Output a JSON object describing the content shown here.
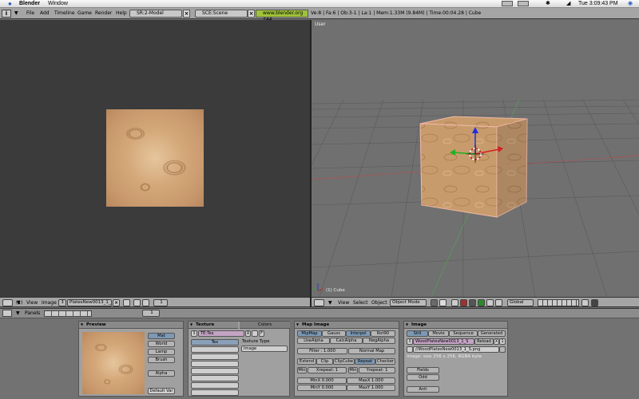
{
  "mac_menu": {
    "app": "Blender",
    "window": "Window",
    "clock": "Tue 3:09:43 PM"
  },
  "header": {
    "menus": [
      "File",
      "Add",
      "Timeline",
      "Game",
      "Render",
      "Help"
    ],
    "screen": "SR:2-Model",
    "scene": "SCE:Scene",
    "url": "www.blender.org 244",
    "stats": "Ve:8 | Fa:6 | Ob:3-1 | La:1  | Mem:1.33M (9.84M)  | Time:00:04.28 | Cube"
  },
  "view3d": {
    "label": "User",
    "object_label": "(1) Cube"
  },
  "image_header": {
    "view": "View",
    "image_label": "Image",
    "image_name": "PlatesNew0013_1_S",
    "frame": "1"
  },
  "view3d_header": {
    "frame": "(1)",
    "menus": [
      "View",
      "Select",
      "Object"
    ],
    "mode": "Object Mode",
    "orientation": "Global"
  },
  "props": {
    "panels_label": "Panels",
    "frame": "1",
    "preview": {
      "title": "Preview",
      "buttons": [
        "Mat",
        "World",
        "Lamp",
        "Brush",
        "Alpha",
        "Default Var"
      ]
    },
    "texture": {
      "tab_texture": "Texture",
      "tab_colors": "Colors",
      "name": "TE:Tex",
      "x": "X",
      "f": "F",
      "list_header": "Tex",
      "type_label": "Texture Type",
      "type_value": "Image"
    },
    "map_image": {
      "title": "Map Image",
      "row1": [
        "MipMap",
        "Gauss",
        "Interpol",
        "Rot90"
      ],
      "row2": [
        "UseAlpha",
        "CalcAlpha",
        "NegAlpha"
      ],
      "filter": "Filter : 1.000",
      "normal_map": "Normal Map",
      "row3": [
        "Extend",
        "Clip",
        "ClipCube",
        "Repeat",
        "Checker"
      ],
      "min_label": "Min",
      "xrepeat": "Xrepeat: 1",
      "yrepeat": "Yrepeat: 1",
      "minx": "MinX 0.000",
      "maxx": "MaxX 1.000",
      "miny": "MinY 0.000",
      "maxy": "MaxY 1.000"
    },
    "image": {
      "title": "Image",
      "tabs": [
        "Still",
        "Movie",
        "Sequence",
        "Generated"
      ],
      "name": "WoodPlatesNew0013_1_S",
      "reload": "Reload",
      "x": "X",
      "users": "1",
      "path": "//WoodPlatesNew0013_1_S.png",
      "info": "Image: size 256 x 256, RGBA byte",
      "fields": "Fields",
      "odd": "Odd",
      "anti": "Anti"
    }
  }
}
